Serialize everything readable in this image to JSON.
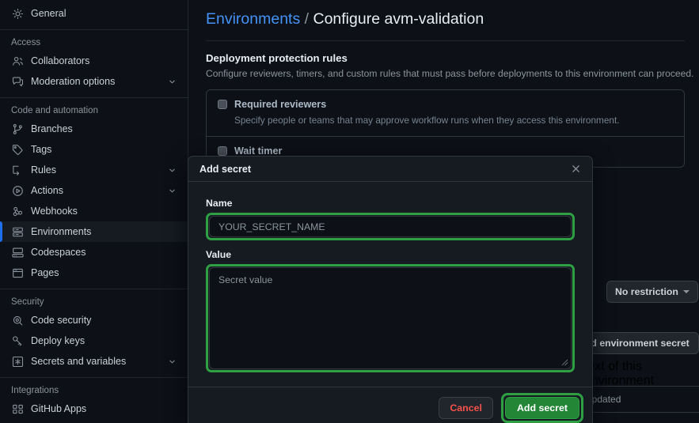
{
  "sidebar": {
    "groups": [
      {
        "title": null,
        "items": [
          {
            "label": "General",
            "icon": "gear-icon",
            "chevron": false,
            "active": false
          }
        ]
      },
      {
        "title": "Access",
        "items": [
          {
            "label": "Collaborators",
            "icon": "people-icon",
            "chevron": false,
            "active": false
          },
          {
            "label": "Moderation options",
            "icon": "comment-icon",
            "chevron": true,
            "active": false
          }
        ]
      },
      {
        "title": "Code and automation",
        "items": [
          {
            "label": "Branches",
            "icon": "git-branch-icon",
            "chevron": false,
            "active": false
          },
          {
            "label": "Tags",
            "icon": "tag-icon",
            "chevron": false,
            "active": false
          },
          {
            "label": "Rules",
            "icon": "rules-icon",
            "chevron": true,
            "active": false
          },
          {
            "label": "Actions",
            "icon": "play-icon",
            "chevron": true,
            "active": false
          },
          {
            "label": "Webhooks",
            "icon": "webhook-icon",
            "chevron": false,
            "active": false
          },
          {
            "label": "Environments",
            "icon": "server-icon",
            "chevron": false,
            "active": true
          },
          {
            "label": "Codespaces",
            "icon": "codespaces-icon",
            "chevron": false,
            "active": false
          },
          {
            "label": "Pages",
            "icon": "browser-icon",
            "chevron": false,
            "active": false
          }
        ]
      },
      {
        "title": "Security",
        "items": [
          {
            "label": "Code security",
            "icon": "shield-scan-icon",
            "chevron": false,
            "active": false
          },
          {
            "label": "Deploy keys",
            "icon": "key-icon",
            "chevron": false,
            "active": false
          },
          {
            "label": "Secrets and variables",
            "icon": "asterisk-box-icon",
            "chevron": true,
            "active": false
          }
        ]
      },
      {
        "title": "Integrations",
        "items": [
          {
            "label": "GitHub Apps",
            "icon": "apps-icon",
            "chevron": false,
            "active": false
          }
        ]
      }
    ]
  },
  "breadcrumb": {
    "link": "Environments",
    "separator": "/",
    "current": "Configure avm-validation"
  },
  "section": {
    "title": "Deployment protection rules",
    "subtitle": "Configure reviewers, timers, and custom rules that must pass before deployments to this environment can proceed."
  },
  "rules": [
    {
      "name": "Required reviewers",
      "description": "Specify people or teams that may approve workflow runs when they access this environment.",
      "checked": false
    },
    {
      "name": "Wait timer",
      "description": "",
      "checked": false
    }
  ],
  "right_widgets": {
    "restriction_dropdown": "No restriction",
    "add_env_secret_button": "Add environment secret",
    "secret_note": "text of this environment",
    "updated_card": "updated"
  },
  "modal": {
    "title": "Add secret",
    "close_icon": "close-icon",
    "name_label": "Name",
    "name_value": "",
    "name_placeholder": "YOUR_SECRET_NAME",
    "value_label": "Value",
    "value_value": "",
    "value_placeholder": "Secret value",
    "cancel_label": "Cancel",
    "submit_label": "Add secret"
  },
  "colors": {
    "page_bg": "#0d1117",
    "modal_bg": "#161b22",
    "border": "#30363d",
    "accent_blue": "#4493f8",
    "highlight_green": "#2ea043",
    "primary_green": "#238636",
    "danger_red": "#f85149",
    "muted_text": "#8b949e"
  }
}
